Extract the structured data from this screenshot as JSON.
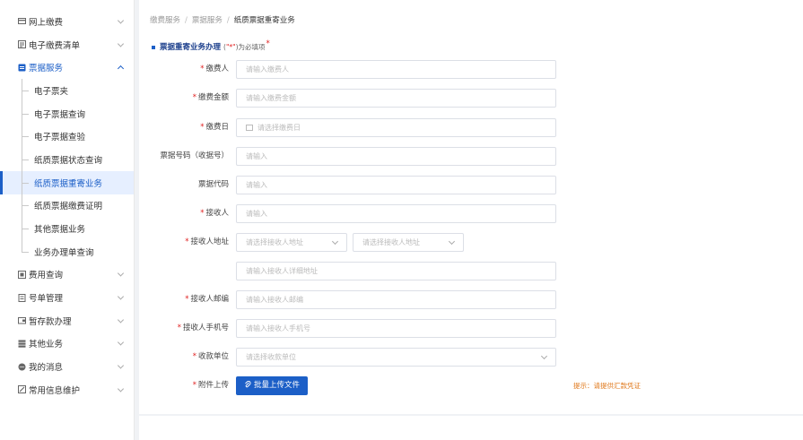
{
  "sidebar": {
    "items": [
      {
        "label": "网上缴费",
        "icon": "card-icon"
      },
      {
        "label": "电子缴费清单",
        "icon": "list-icon"
      },
      {
        "label": "票据服务",
        "icon": "receipt-icon",
        "open": true,
        "children": [
          "电子票夹",
          "电子票据查询",
          "电子票据查验",
          "纸质票据状态查询",
          "纸质票据重寄业务",
          "纸质票据缴费证明",
          "其他票据业务",
          "业务办理单查询"
        ],
        "active_child": "纸质票据重寄业务"
      },
      {
        "label": "费用查询",
        "icon": "query-icon"
      },
      {
        "label": "号单管理",
        "icon": "document-icon"
      },
      {
        "label": "暂存款办理",
        "icon": "wallet-icon"
      },
      {
        "label": "其他业务",
        "icon": "stack-icon"
      },
      {
        "label": "我的消息",
        "icon": "message-icon"
      },
      {
        "label": "常用信息维护",
        "icon": "edit-icon"
      }
    ]
  },
  "breadcrumb": [
    "缴费服务",
    "票据服务",
    "纸质票据重寄业务"
  ],
  "form": {
    "title": "票据重寄业务办理",
    "required_note_prefix": "(",
    "required_note_mark": "\"*\"",
    "required_note_suffix": ")为必填项",
    "required_star": "*",
    "fields": {
      "payer": {
        "label": "缴费人",
        "required": true,
        "placeholder": "请输入缴费人"
      },
      "amount": {
        "label": "缴费金额",
        "required": true,
        "placeholder": "请输入缴费金额"
      },
      "date": {
        "label": "缴费日",
        "required": true,
        "placeholder": "请选择缴费日"
      },
      "receipt_no": {
        "label": "票据号码（收据号）",
        "required": false,
        "placeholder": "请输入"
      },
      "receipt_code": {
        "label": "票据代码",
        "required": false,
        "placeholder": "请输入"
      },
      "recipient": {
        "label": "接收人",
        "required": true,
        "placeholder": "请输入"
      },
      "address": {
        "label": "接收人地址",
        "required": true,
        "select1": "请选择接收人地址",
        "select2": "请选择接收人地址",
        "detail_placeholder": "请输入接收人详细地址"
      },
      "postcode": {
        "label": "接收人邮编",
        "required": true,
        "placeholder": "请输入接收人邮编"
      },
      "phone": {
        "label": "接收人手机号",
        "required": true,
        "placeholder": "请输入接收人手机号"
      },
      "payee": {
        "label": "收款单位",
        "required": true,
        "placeholder": "请选择收款单位"
      },
      "attachment": {
        "label": "附件上传",
        "required": true,
        "button": "批量上传文件",
        "tip": "提示：请提供汇款凭证"
      }
    }
  },
  "colors": {
    "accent": "#1c5fc7",
    "required": "#e02020",
    "tip": "#e0791c"
  }
}
